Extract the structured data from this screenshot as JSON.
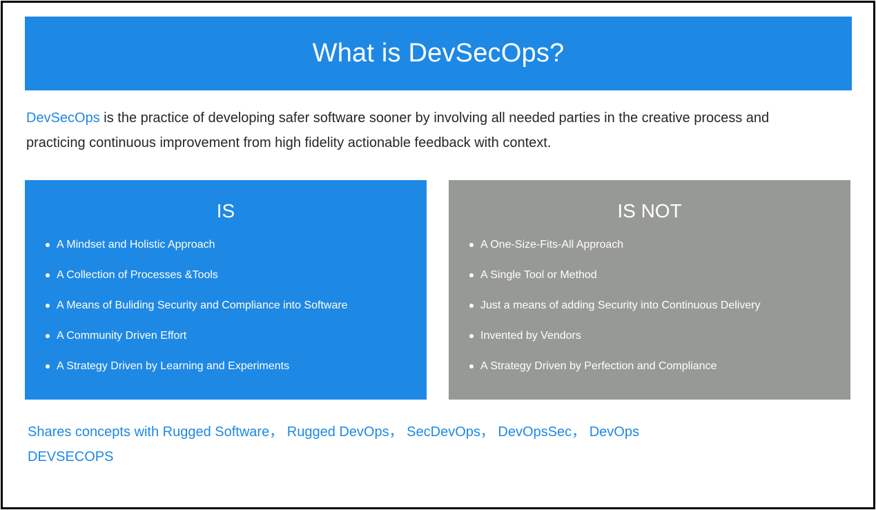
{
  "title": "What is DevSecOps?",
  "definition": {
    "term": "DevSecOps",
    "line1": " is the practice of developing safer software sooner by involving all needed parties in the creative process and",
    "line2": "practicing continuous improvement from high fidelity actionable feedback with context."
  },
  "is_panel": {
    "heading": "IS",
    "items": [
      {
        "label": "A Mindset and Holistic Approach"
      },
      {
        "label": "A Collection of Processes &Tools"
      },
      {
        "label": "A Means of Buliding Security and Compliance into Software"
      },
      {
        "label": "A Community Driven Effort"
      },
      {
        "label": "A Strategy Driven by Learning and Experiments"
      }
    ]
  },
  "is_not_panel": {
    "heading": "IS NOT",
    "items": [
      {
        "label": "A One-Size-Fits-All Approach"
      },
      {
        "label": "A Single Tool or Method"
      },
      {
        "label": "Just a means of adding Security into Continuous Delivery"
      },
      {
        "label": "Invented by Vendors"
      },
      {
        "label": "A Strategy Driven by Perfection and Compliance"
      }
    ]
  },
  "shares": {
    "line1": "Shares concepts with Rugged Software， Rugged DevOps， SecDevOps， DevOpsSec， DevOps",
    "line2": "DEVSECOPS"
  },
  "colors": {
    "accent_blue": "#1e88e5",
    "panel_gray": "#979994",
    "body_text": "#262626"
  }
}
